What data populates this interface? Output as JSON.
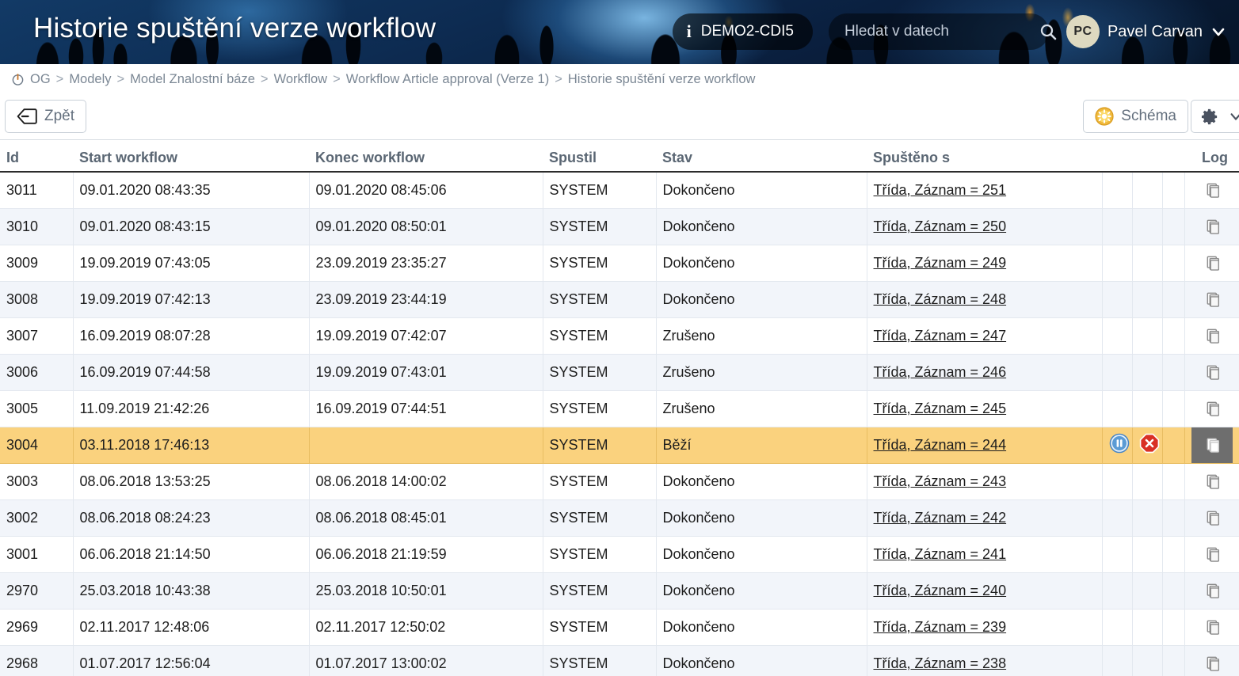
{
  "header": {
    "title": "Historie spuštění verze workflow",
    "env_badge": "DEMO2-CDI5",
    "info_icon": "info-icon",
    "search_placeholder": "Hledat v datech",
    "search_value": "",
    "search_icon": "search-icon",
    "avatar_initials": "PC",
    "user_name": "Pavel Carvan",
    "caret_icon": "chevron-down-icon"
  },
  "breadcrumb": {
    "power_icon": "power-icon",
    "separator": ">",
    "items": [
      {
        "label": "OG"
      },
      {
        "label": "Modely"
      },
      {
        "label": "Model Znalostní báze"
      },
      {
        "label": "Workflow"
      },
      {
        "label": "Workflow Article approval (Verze 1)"
      },
      {
        "label": "Historie spuštění verze workflow"
      }
    ]
  },
  "toolbar": {
    "back_label": "Zpět",
    "back_icon": "back-arrow-icon",
    "schema_label": "Schéma",
    "schema_icon": "sun-gear-icon",
    "settings_icon": "gear-icon",
    "settings_caret_icon": "chevron-down-icon"
  },
  "table": {
    "columns": [
      {
        "key": "id",
        "label": "Id"
      },
      {
        "key": "start",
        "label": "Start workflow"
      },
      {
        "key": "end",
        "label": "Konec workflow"
      },
      {
        "key": "started_by",
        "label": "Spustil"
      },
      {
        "key": "state",
        "label": "Stav"
      },
      {
        "key": "started_with",
        "label": "Spuštěno s"
      },
      {
        "key": "a1",
        "label": ""
      },
      {
        "key": "a2",
        "label": ""
      },
      {
        "key": "a3",
        "label": ""
      },
      {
        "key": "log",
        "label": "Log"
      }
    ],
    "log_icon": "copy-pages-icon",
    "pause_icon": "pause-icon",
    "stop_icon": "stop-cancel-icon",
    "rows": [
      {
        "id": "3011",
        "start": "09.01.2020 08:43:35",
        "end": "09.01.2020 08:45:06",
        "started_by": "SYSTEM",
        "state": "Dokončeno",
        "started_with": "Třída, Záznam = 251",
        "running": false
      },
      {
        "id": "3010",
        "start": "09.01.2020 08:43:15",
        "end": "09.01.2020 08:50:01",
        "started_by": "SYSTEM",
        "state": "Dokončeno",
        "started_with": "Třída, Záznam = 250",
        "running": false
      },
      {
        "id": "3009",
        "start": "19.09.2019 07:43:05",
        "end": "23.09.2019 23:35:27",
        "started_by": "SYSTEM",
        "state": "Dokončeno",
        "started_with": "Třída, Záznam = 249",
        "running": false
      },
      {
        "id": "3008",
        "start": "19.09.2019 07:42:13",
        "end": "23.09.2019 23:44:19",
        "started_by": "SYSTEM",
        "state": "Dokončeno",
        "started_with": "Třída, Záznam = 248",
        "running": false
      },
      {
        "id": "3007",
        "start": "16.09.2019 08:07:28",
        "end": "19.09.2019 07:42:07",
        "started_by": "SYSTEM",
        "state": "Zrušeno",
        "started_with": "Třída, Záznam = 247",
        "running": false
      },
      {
        "id": "3006",
        "start": "16.09.2019 07:44:58",
        "end": "19.09.2019 07:43:01",
        "started_by": "SYSTEM",
        "state": "Zrušeno",
        "started_with": "Třída, Záznam = 246",
        "running": false
      },
      {
        "id": "3005",
        "start": "11.09.2019 21:42:26",
        "end": "16.09.2019 07:44:51",
        "started_by": "SYSTEM",
        "state": "Zrušeno",
        "started_with": "Třída, Záznam = 245",
        "running": false
      },
      {
        "id": "3004",
        "start": "03.11.2018 17:46:13",
        "end": "",
        "started_by": "SYSTEM",
        "state": "Běží",
        "started_with": "Třída, Záznam = 244",
        "running": true
      },
      {
        "id": "3003",
        "start": "08.06.2018 13:53:25",
        "end": "08.06.2018 14:00:02",
        "started_by": "SYSTEM",
        "state": "Dokončeno",
        "started_with": "Třída, Záznam = 243",
        "running": false
      },
      {
        "id": "3002",
        "start": "08.06.2018 08:24:23",
        "end": "08.06.2018 08:45:01",
        "started_by": "SYSTEM",
        "state": "Dokončeno",
        "started_with": "Třída, Záznam = 242",
        "running": false
      },
      {
        "id": "3001",
        "start": "06.06.2018 21:14:50",
        "end": "06.06.2018 21:19:59",
        "started_by": "SYSTEM",
        "state": "Dokončeno",
        "started_with": "Třída, Záznam = 241",
        "running": false
      },
      {
        "id": "2970",
        "start": "25.03.2018 10:43:38",
        "end": "25.03.2018 10:50:01",
        "started_by": "SYSTEM",
        "state": "Dokončeno",
        "started_with": "Třída, Záznam = 240",
        "running": false
      },
      {
        "id": "2969",
        "start": "02.11.2017 12:48:06",
        "end": "02.11.2017 12:50:02",
        "started_by": "SYSTEM",
        "state": "Dokončeno",
        "started_with": "Třída, Záznam = 239",
        "running": false
      },
      {
        "id": "2968",
        "start": "01.07.2017 12:56:04",
        "end": "01.07.2017 13:00:02",
        "started_by": "SYSTEM",
        "state": "Dokončeno",
        "started_with": "Třída, Záznam = 238",
        "running": false
      }
    ]
  },
  "colors": {
    "banner_dark_blue": "#0d2b51",
    "header_text": "#ffffff",
    "breadcrumb_text": "#7b8794",
    "table_header_text": "#5a6673",
    "row_alt": "#f2f5fa",
    "running_row": "#fad27e",
    "accent_yellow": "#f5c33b",
    "stop_red": "#d93025",
    "pause_blue": "#5b9bd5"
  }
}
